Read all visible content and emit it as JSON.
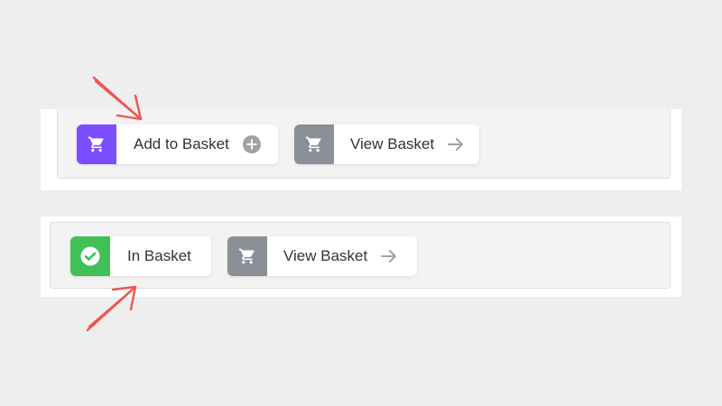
{
  "top_section": {
    "add_to_basket": {
      "label": "Add to Basket",
      "icon": "cart-icon",
      "trail_icon": "plus-circle-icon",
      "accent": "#7c4dff"
    },
    "view_basket": {
      "label": "View Basket",
      "icon": "cart-icon",
      "trail_icon": "arrow-right-icon",
      "accent": "#8a9097"
    }
  },
  "bottom_section": {
    "in_basket": {
      "label": "In Basket",
      "icon": "check-circle-icon",
      "accent": "#40c057"
    },
    "view_basket": {
      "label": "View Basket",
      "icon": "cart-icon",
      "trail_icon": "arrow-right-icon",
      "accent": "#8a9097"
    }
  },
  "annotations": {
    "color": "#f05454"
  }
}
